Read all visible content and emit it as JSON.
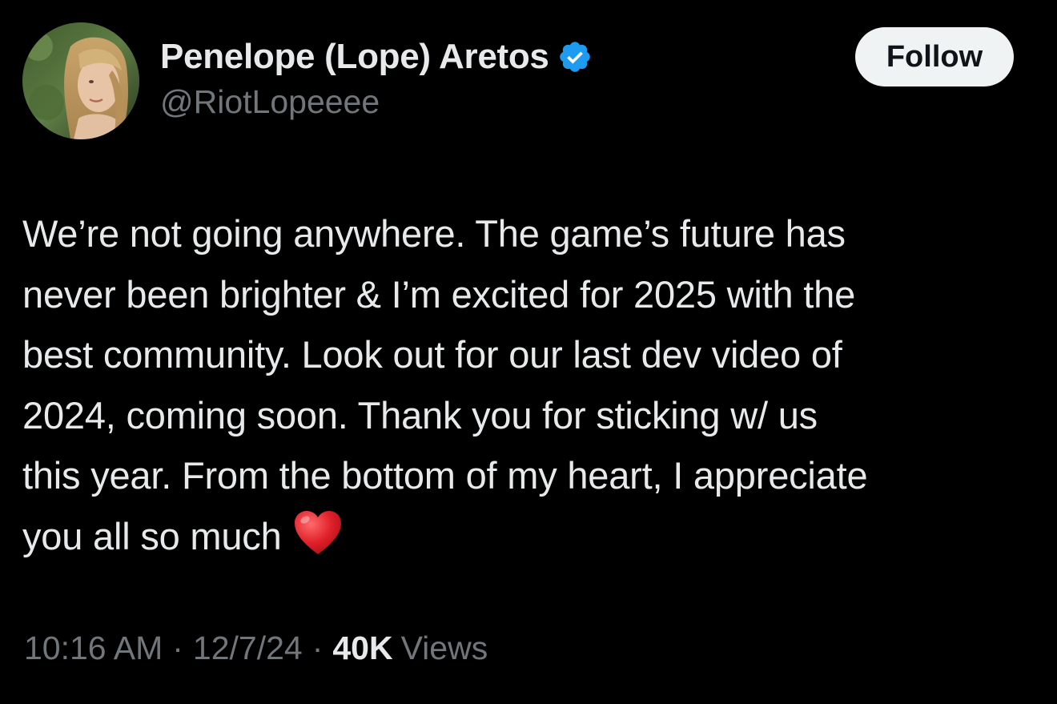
{
  "author": {
    "display_name": "Penelope (Lope) Aretos",
    "handle": "@RiotLopeeee",
    "verified": true,
    "verified_color": "#1d9bf0",
    "avatar": "profile-photo"
  },
  "follow_label": "Follow",
  "tweet": {
    "lines": [
      "We’re not going anywhere. The game’s future has",
      "never been brighter & I’m excited for 2025 with the",
      "best community. Look out for our last dev video of",
      "2024, coming soon. Thank you for sticking w/ us",
      "this year. From the bottom of my heart, I appreciate",
      "you all so much"
    ],
    "emoji": "red-heart-icon"
  },
  "meta": {
    "time": "10:16 AM",
    "separator": "·",
    "date": "12/7/24",
    "views_count": "40K",
    "views_label": "Views"
  },
  "colors": {
    "background": "#000000",
    "text": "#e7e9ea",
    "secondary_text": "#71767b",
    "follow_bg": "#eff3f4",
    "heart": "#e0202a"
  }
}
